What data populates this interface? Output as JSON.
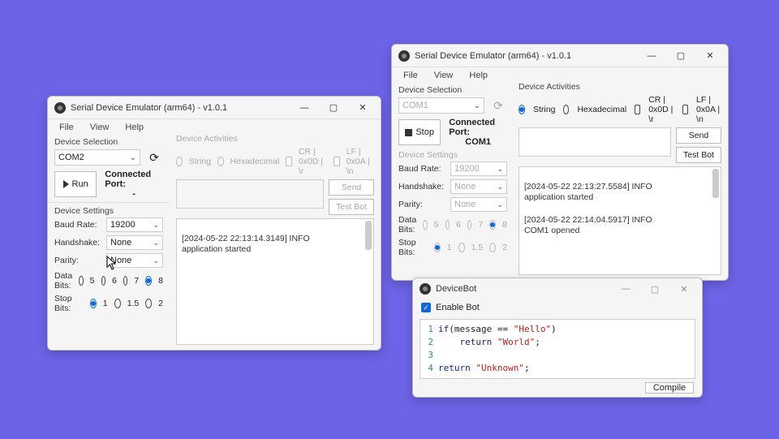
{
  "win1": {
    "title": "Serial Device Emulator (arm64) - v1.0.1",
    "menu": {
      "file": "File",
      "view": "View",
      "help": "Help"
    },
    "device_selection_label": "Device Selection",
    "port": "COM2",
    "run_btn": "Run",
    "connected_port_label": "Connected Port:",
    "connected_port_value": "-",
    "device_settings_label": "Device Settings",
    "baud_label": "Baud Rate:",
    "baud": "19200",
    "handshake_label": "Handshake:",
    "handshake": "None",
    "parity_label": "Parity:",
    "parity": "None",
    "databits_label": "Data Bits:",
    "databits_opts": [
      "5",
      "6",
      "7",
      "8"
    ],
    "databits_sel": "8",
    "stopbits_label": "Stop Bits:",
    "stopbits_opts": [
      "1",
      "1.5",
      "2"
    ],
    "stopbits_sel": "1",
    "activities_label": "Device Activities",
    "fmt_string": "String",
    "fmt_hex": "Hexadecimal",
    "cr_label": "CR | 0x0D | \\r",
    "lf_label": "LF | 0x0A | \\n",
    "send_btn": "Send",
    "testbot_btn": "Test Bot",
    "log": "[2024-05-22 22:13:14.3149] INFO\napplication started"
  },
  "win2": {
    "title": "Serial Device Emulator (arm64) - v1.0.1",
    "menu": {
      "file": "File",
      "view": "View",
      "help": "Help"
    },
    "device_selection_label": "Device Selection",
    "port": "COM1",
    "stop_btn": "Stop",
    "connected_port_label": "Connected Port:",
    "connected_port_value": "COM1",
    "device_settings_label": "Device Settings",
    "baud_label": "Baud Rate:",
    "baud": "19200",
    "handshake_label": "Handshake:",
    "handshake": "None",
    "parity_label": "Parity:",
    "parity": "None",
    "databits_label": "Data Bits:",
    "databits_opts": [
      "5",
      "6",
      "7",
      "8"
    ],
    "databits_sel": "8",
    "stopbits_label": "Stop Bits:",
    "stopbits_opts": [
      "1",
      "1.5",
      "2"
    ],
    "stopbits_sel": "1",
    "activities_label": "Device Activities",
    "fmt_string": "String",
    "fmt_hex": "Hexadecimal",
    "cr_label": "CR | 0x0D | \\r",
    "lf_label": "LF | 0x0A | \\n",
    "send_btn": "Send",
    "testbot_btn": "Test Bot",
    "log": "[2024-05-22 22:13:27.5584] INFO\napplication started\n\n[2024-05-22 22:14:04.5917] INFO\nCOM1 opened"
  },
  "win3": {
    "title": "DeviceBot",
    "enable_label": "Enable Bot",
    "compile_btn": "Compile",
    "code_lines": [
      "1",
      "2",
      "3",
      "4"
    ],
    "code_html": "<span class='kw'>if</span>(message == <span class='str'>\"Hello\"</span>)\n    <span class='kw'>return</span> <span class='str'>\"World\"</span>;\n\n<span class='kw'>return</span> <span class='str'>\"Unknown\"</span>;"
  }
}
